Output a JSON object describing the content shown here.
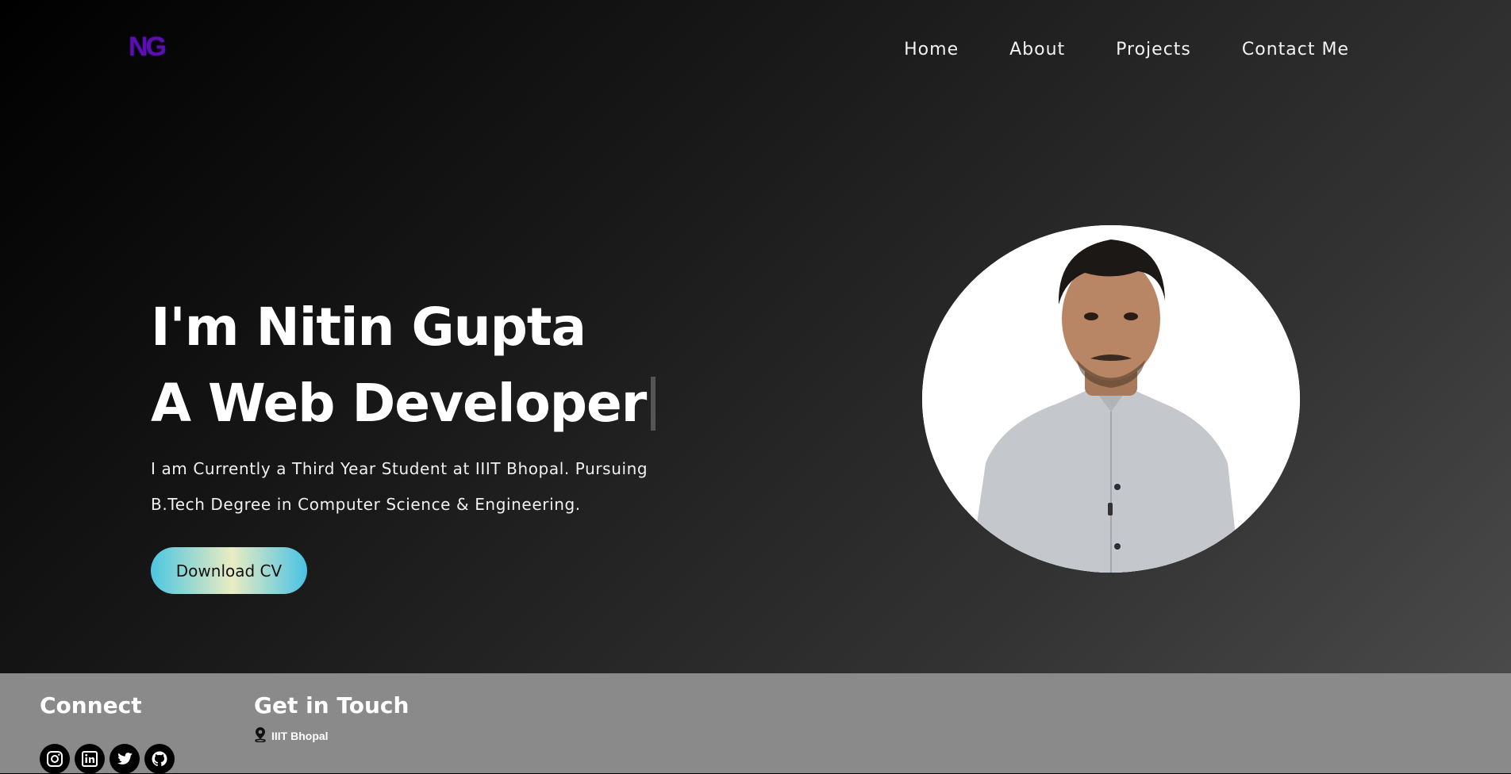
{
  "header": {
    "logo": "NG",
    "nav": [
      {
        "label": "Home"
      },
      {
        "label": "About"
      },
      {
        "label": "Projects"
      },
      {
        "label": "Contact Me"
      }
    ]
  },
  "hero": {
    "greeting": "I'm Nitin Gupta",
    "role": "A Web Developer",
    "bio_line1": "I am Currently a Third Year Student at IIIT Bhopal. Pursuing",
    "bio_line2": "B.Tech Degree in Computer Science & Engineering.",
    "cta_label": "Download CV"
  },
  "footer": {
    "connect_title": "Connect",
    "socials": [
      "instagram-icon",
      "linkedin-icon",
      "twitter-icon",
      "github-icon"
    ],
    "contact_title": "Get in Touch",
    "location": "IIIT Bhopal"
  },
  "colors": {
    "logo": "#5a0fb0",
    "footer_bg": "#8a8a8a",
    "button_gradient": [
      "#4cc6e0",
      "#e9ecc2",
      "#49c2e3"
    ]
  }
}
